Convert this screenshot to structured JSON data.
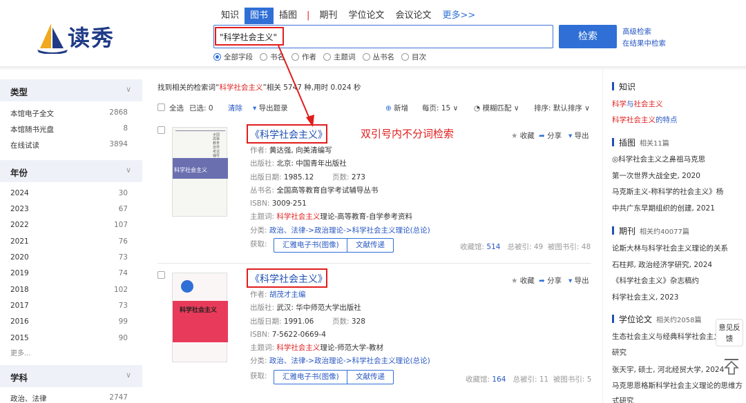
{
  "logo": {
    "text": "读秀"
  },
  "nav": {
    "tabs": [
      {
        "label": "知识",
        "active": false
      },
      {
        "label": "图书",
        "active": true
      },
      {
        "label": "插图",
        "active": false
      },
      {
        "label": "期刊",
        "active": false
      },
      {
        "label": "学位论文",
        "active": false
      },
      {
        "label": "会议论文",
        "active": false
      }
    ],
    "separator": "|",
    "more": "更多>>"
  },
  "search": {
    "query": "\"科学社会主义\"",
    "button": "检索",
    "advanced": "高级检索",
    "within": "在结果中检索"
  },
  "fields": [
    {
      "label": "全部字段",
      "checked": true
    },
    {
      "label": "书名",
      "checked": false
    },
    {
      "label": "作者",
      "checked": false
    },
    {
      "label": "主题词",
      "checked": false
    },
    {
      "label": "丛书名",
      "checked": false
    },
    {
      "label": "目次",
      "checked": false
    }
  ],
  "facets": {
    "type": {
      "title": "类型",
      "items": [
        {
          "label": "本馆电子全文",
          "count": "2868"
        },
        {
          "label": "本馆随书光盘",
          "count": "8"
        },
        {
          "label": "在线试读",
          "count": "3894"
        }
      ]
    },
    "year": {
      "title": "年份",
      "items": [
        {
          "label": "2024",
          "count": "30"
        },
        {
          "label": "2023",
          "count": "67"
        },
        {
          "label": "2022",
          "count": "107"
        },
        {
          "label": "2021",
          "count": "76"
        },
        {
          "label": "2020",
          "count": "73"
        },
        {
          "label": "2019",
          "count": "74"
        },
        {
          "label": "2018",
          "count": "102"
        },
        {
          "label": "2017",
          "count": "73"
        },
        {
          "label": "2016",
          "count": "99"
        },
        {
          "label": "2015",
          "count": "90"
        }
      ],
      "more": "更多..."
    },
    "subject": {
      "title": "学科",
      "items": [
        {
          "label": "政治、法律",
          "count": "2747"
        }
      ]
    }
  },
  "summary": {
    "prefix": "找到相关的检索词“",
    "term": "科学社会主义",
    "suffix": "”相关 5747 种,用时 0.024 秒"
  },
  "toolbar": {
    "select_all": "全选",
    "selected": "已选: 0",
    "clear": "清除",
    "export": "导出题录",
    "new": "新增",
    "per_page": "每页:  15 ∨",
    "fuzzy": "模糊匹配 ∨",
    "sort": "排序:  默认排序 ∨"
  },
  "annotation": "双引号内不分词检索",
  "results": [
    {
      "title": "《科学社会主义》",
      "cover_label": "科学社会主义",
      "cover_series": "全国高等教育自学考试辅导丛书",
      "labels": {
        "author": "作者:",
        "publisher": "出版社:",
        "date": "出版日期:",
        "pages": "页数:",
        "series": "丛书名:",
        "isbn": "ISBN:",
        "subject": "主题词:",
        "class": "分类:",
        "get": "获取:"
      },
      "author": "黄达强, 向美清编写",
      "publisher": "北京: 中国青年出版社",
      "date": "1985.12",
      "pages": "273",
      "series": "全国高等教育自学考试辅导丛书",
      "isbn": "3009·251",
      "subject_hl": "科学社会主义",
      "subject_rest": "理论-高等教育-自学参考资料",
      "class": "政治、法律->政治理论->科学社会主义理论(总论)",
      "btn1": "汇雅电子书(图像)",
      "btn2": "文献传递",
      "stats": {
        "holdings_label": "收藏馆:",
        "holdings": "514",
        "cited_label": "总被引:",
        "cited": "49",
        "cited_books_label": "被图书引:",
        "cited_books": "48"
      },
      "actions": {
        "fav": "收藏",
        "share": "分享",
        "export": "导出"
      }
    },
    {
      "title": "《科学社会主义》",
      "cover_label": "科学社会主义",
      "cover_series": "",
      "labels": {
        "author": "作者:",
        "publisher": "出版社:",
        "date": "出版日期:",
        "pages": "页数:",
        "isbn": "ISBN:",
        "subject": "主题词:",
        "class": "分类:",
        "get": "获取:"
      },
      "author": "胡茂才主编",
      "publisher": "武汉: 华中师范大学出版社",
      "date": "1991.06",
      "pages": "328",
      "isbn": "7-5622-0669-4",
      "subject_hl": "科学社会主义",
      "subject_rest": "理论-师范大学-教材",
      "class": "政治、法律->政治理论->科学社会主义理论(总论)",
      "btn1": "汇雅电子书(图像)",
      "btn2": "文献传递",
      "stats": {
        "holdings_label": "收藏馆:",
        "holdings": "164",
        "cited_label": "总被引:",
        "cited": "11",
        "cited_books_label": "被图书引:",
        "cited_books": "5"
      },
      "actions": {
        "fav": "收藏",
        "share": "分享",
        "export": "导出"
      }
    }
  ],
  "right": {
    "knowledge": {
      "title": "知识",
      "items": [
        {
          "a": "科学",
          "b": "与",
          "c": "社会主义"
        },
        {
          "a": "科学社会主义",
          "b": "的特点",
          "c": ""
        }
      ]
    },
    "figures": {
      "title": "插图",
      "count": "相关11篇",
      "items": [
        {
          "link": "◎科学社会主义之鼻祖马克思",
          "src": "第一次世界大战全史, 2020"
        },
        {
          "link": "马克斯主义-称科学的社会主义》杨",
          "src": "中共广东早期组织的创建, 2021"
        }
      ]
    },
    "journals": {
      "title": "期刊",
      "count": "相关约40077篇",
      "items": [
        {
          "link": "论斯大林与科学社会主义理论的关系",
          "src": "石柱邦, 政治经济学研究, 2024"
        },
        {
          "link": "《科学社会主义》杂志稿约",
          "src": "科学社会主义, 2023"
        }
      ]
    },
    "theses": {
      "title": "学位论文",
      "count": "相关约2058篇",
      "items": [
        {
          "link": "生态社会主义与经典科学社会主义",
          "link2": "研究",
          "src": "张天宇, 硕士, 河北经贸大学, 2024"
        },
        {
          "link": "马克思恩格斯科学社会主义理论的思维方",
          "link2": "式研究",
          "src": ""
        }
      ]
    }
  },
  "feedback": "意见反馈",
  "colors": {
    "primary": "#2f6fd6",
    "highlight": "#e02020",
    "annotation_red": "#e21b1b",
    "link": "#2756c2"
  }
}
